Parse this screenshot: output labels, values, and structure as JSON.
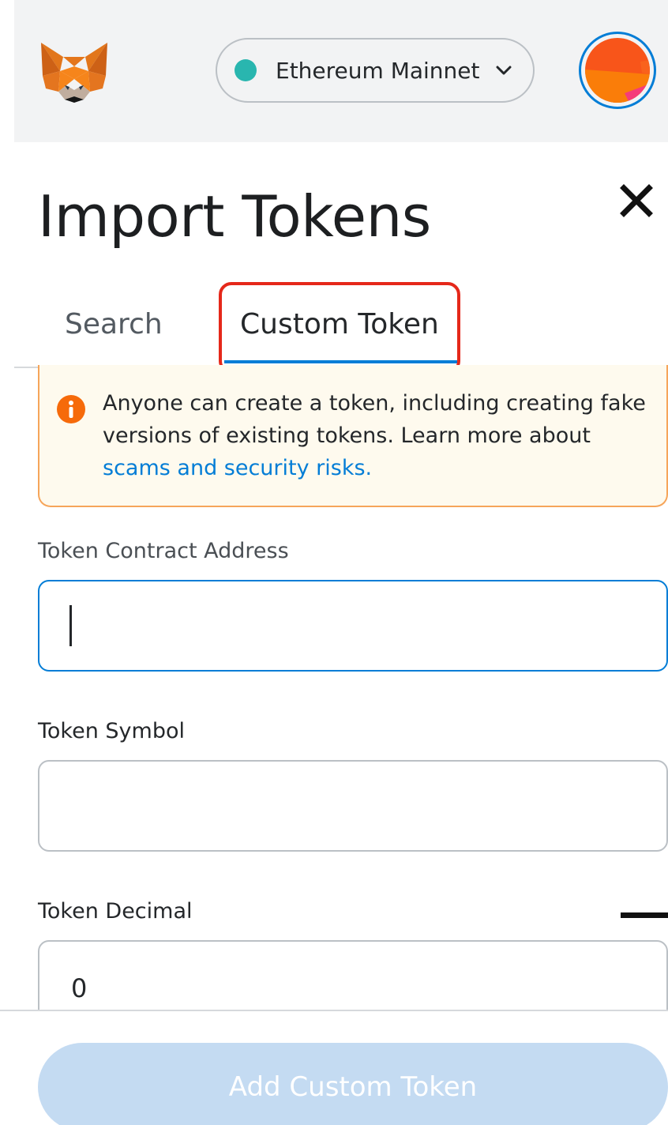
{
  "header": {
    "logo_icon": "metamask-fox-icon",
    "network": {
      "label": "Ethereum Mainnet",
      "status_color": "#29b6af",
      "icon": "chevron-down-icon"
    },
    "account_avatar_icon": "account-avatar-icon"
  },
  "page": {
    "title": "Import Tokens",
    "close_icon": "close-icon"
  },
  "tabs": [
    {
      "label": "Search",
      "active": false
    },
    {
      "label": "Custom Token",
      "active": true
    }
  ],
  "warning": {
    "icon": "info-icon",
    "text": "Anyone can create a token, including creating fake versions of existing tokens. Learn more about ",
    "link_text": "scams and security risks."
  },
  "form": {
    "address": {
      "label": "Token Contract Address",
      "value": ""
    },
    "symbol": {
      "label": "Token Symbol",
      "value": ""
    },
    "decimal": {
      "label": "Token Decimal",
      "value": "0"
    }
  },
  "footer": {
    "button_label": "Add Custom Token",
    "button_enabled": false
  },
  "colors": {
    "accent": "#037dd6",
    "highlight": "#e5281a",
    "warning_border": "#f6a55a",
    "warning_bg": "#fefaee",
    "button_disabled": "#c4dbf2"
  }
}
